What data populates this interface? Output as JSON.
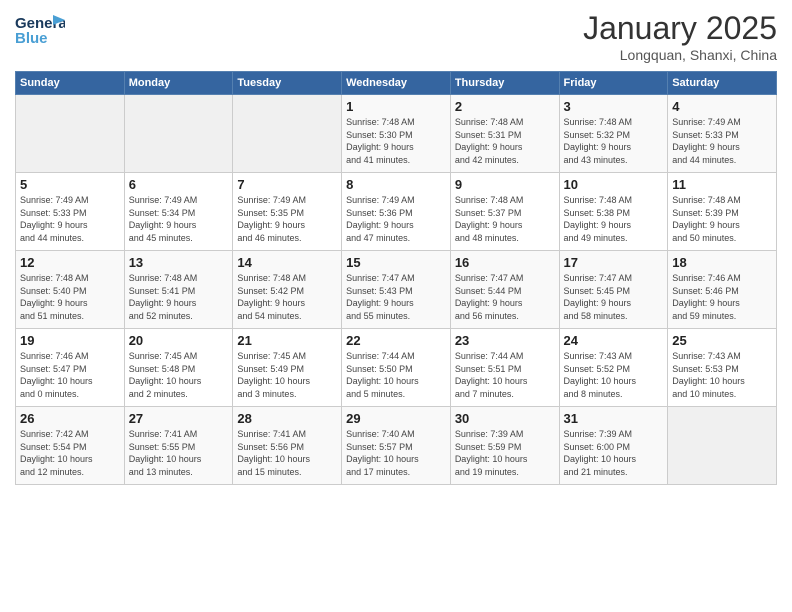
{
  "logo": {
    "line1": "General",
    "line2": "Blue"
  },
  "title": "January 2025",
  "location": "Longquan, Shanxi, China",
  "headers": [
    "Sunday",
    "Monday",
    "Tuesday",
    "Wednesday",
    "Thursday",
    "Friday",
    "Saturday"
  ],
  "weeks": [
    [
      {
        "day": "",
        "info": ""
      },
      {
        "day": "",
        "info": ""
      },
      {
        "day": "",
        "info": ""
      },
      {
        "day": "1",
        "info": "Sunrise: 7:48 AM\nSunset: 5:30 PM\nDaylight: 9 hours\nand 41 minutes."
      },
      {
        "day": "2",
        "info": "Sunrise: 7:48 AM\nSunset: 5:31 PM\nDaylight: 9 hours\nand 42 minutes."
      },
      {
        "day": "3",
        "info": "Sunrise: 7:48 AM\nSunset: 5:32 PM\nDaylight: 9 hours\nand 43 minutes."
      },
      {
        "day": "4",
        "info": "Sunrise: 7:49 AM\nSunset: 5:33 PM\nDaylight: 9 hours\nand 44 minutes."
      }
    ],
    [
      {
        "day": "5",
        "info": "Sunrise: 7:49 AM\nSunset: 5:33 PM\nDaylight: 9 hours\nand 44 minutes."
      },
      {
        "day": "6",
        "info": "Sunrise: 7:49 AM\nSunset: 5:34 PM\nDaylight: 9 hours\nand 45 minutes."
      },
      {
        "day": "7",
        "info": "Sunrise: 7:49 AM\nSunset: 5:35 PM\nDaylight: 9 hours\nand 46 minutes."
      },
      {
        "day": "8",
        "info": "Sunrise: 7:49 AM\nSunset: 5:36 PM\nDaylight: 9 hours\nand 47 minutes."
      },
      {
        "day": "9",
        "info": "Sunrise: 7:48 AM\nSunset: 5:37 PM\nDaylight: 9 hours\nand 48 minutes."
      },
      {
        "day": "10",
        "info": "Sunrise: 7:48 AM\nSunset: 5:38 PM\nDaylight: 9 hours\nand 49 minutes."
      },
      {
        "day": "11",
        "info": "Sunrise: 7:48 AM\nSunset: 5:39 PM\nDaylight: 9 hours\nand 50 minutes."
      }
    ],
    [
      {
        "day": "12",
        "info": "Sunrise: 7:48 AM\nSunset: 5:40 PM\nDaylight: 9 hours\nand 51 minutes."
      },
      {
        "day": "13",
        "info": "Sunrise: 7:48 AM\nSunset: 5:41 PM\nDaylight: 9 hours\nand 52 minutes."
      },
      {
        "day": "14",
        "info": "Sunrise: 7:48 AM\nSunset: 5:42 PM\nDaylight: 9 hours\nand 54 minutes."
      },
      {
        "day": "15",
        "info": "Sunrise: 7:47 AM\nSunset: 5:43 PM\nDaylight: 9 hours\nand 55 minutes."
      },
      {
        "day": "16",
        "info": "Sunrise: 7:47 AM\nSunset: 5:44 PM\nDaylight: 9 hours\nand 56 minutes."
      },
      {
        "day": "17",
        "info": "Sunrise: 7:47 AM\nSunset: 5:45 PM\nDaylight: 9 hours\nand 58 minutes."
      },
      {
        "day": "18",
        "info": "Sunrise: 7:46 AM\nSunset: 5:46 PM\nDaylight: 9 hours\nand 59 minutes."
      }
    ],
    [
      {
        "day": "19",
        "info": "Sunrise: 7:46 AM\nSunset: 5:47 PM\nDaylight: 10 hours\nand 0 minutes."
      },
      {
        "day": "20",
        "info": "Sunrise: 7:45 AM\nSunset: 5:48 PM\nDaylight: 10 hours\nand 2 minutes."
      },
      {
        "day": "21",
        "info": "Sunrise: 7:45 AM\nSunset: 5:49 PM\nDaylight: 10 hours\nand 3 minutes."
      },
      {
        "day": "22",
        "info": "Sunrise: 7:44 AM\nSunset: 5:50 PM\nDaylight: 10 hours\nand 5 minutes."
      },
      {
        "day": "23",
        "info": "Sunrise: 7:44 AM\nSunset: 5:51 PM\nDaylight: 10 hours\nand 7 minutes."
      },
      {
        "day": "24",
        "info": "Sunrise: 7:43 AM\nSunset: 5:52 PM\nDaylight: 10 hours\nand 8 minutes."
      },
      {
        "day": "25",
        "info": "Sunrise: 7:43 AM\nSunset: 5:53 PM\nDaylight: 10 hours\nand 10 minutes."
      }
    ],
    [
      {
        "day": "26",
        "info": "Sunrise: 7:42 AM\nSunset: 5:54 PM\nDaylight: 10 hours\nand 12 minutes."
      },
      {
        "day": "27",
        "info": "Sunrise: 7:41 AM\nSunset: 5:55 PM\nDaylight: 10 hours\nand 13 minutes."
      },
      {
        "day": "28",
        "info": "Sunrise: 7:41 AM\nSunset: 5:56 PM\nDaylight: 10 hours\nand 15 minutes."
      },
      {
        "day": "29",
        "info": "Sunrise: 7:40 AM\nSunset: 5:57 PM\nDaylight: 10 hours\nand 17 minutes."
      },
      {
        "day": "30",
        "info": "Sunrise: 7:39 AM\nSunset: 5:59 PM\nDaylight: 10 hours\nand 19 minutes."
      },
      {
        "day": "31",
        "info": "Sunrise: 7:39 AM\nSunset: 6:00 PM\nDaylight: 10 hours\nand 21 minutes."
      },
      {
        "day": "",
        "info": ""
      }
    ]
  ]
}
